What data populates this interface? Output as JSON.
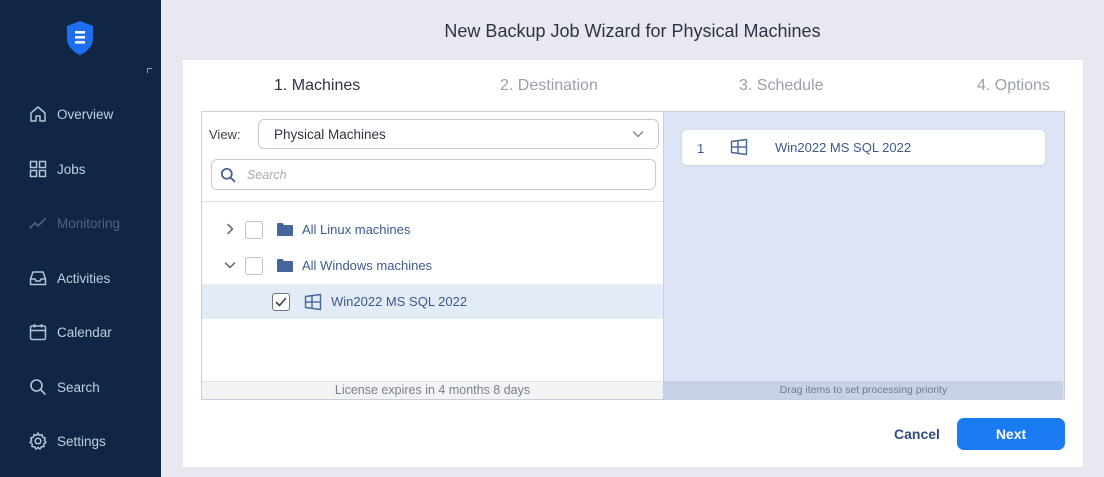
{
  "app": {
    "title": "New Backup Job Wizard for Physical Machines",
    "logo_icon": "shield-logo-icon",
    "accent_color": "#1a7af0"
  },
  "sidebar": {
    "items": [
      {
        "label": "Overview",
        "icon": "home-icon",
        "enabled": true
      },
      {
        "label": "Jobs",
        "icon": "grid-icon",
        "enabled": true
      },
      {
        "label": "Monitoring",
        "icon": "chart-line-icon",
        "enabled": false
      },
      {
        "label": "Activities",
        "icon": "inbox-icon",
        "enabled": true
      },
      {
        "label": "Calendar",
        "icon": "calendar-icon",
        "enabled": true
      },
      {
        "label": "Search",
        "icon": "search-icon",
        "enabled": true
      },
      {
        "label": "Settings",
        "icon": "gear-icon",
        "enabled": true
      }
    ]
  },
  "wizard": {
    "steps": [
      {
        "label": "1. Machines",
        "active": true
      },
      {
        "label": "2. Destination",
        "active": false
      },
      {
        "label": "3. Schedule",
        "active": false
      },
      {
        "label": "4. Options",
        "active": false
      }
    ]
  },
  "inventory": {
    "view_label": "View:",
    "view_value": "Physical Machines",
    "search_placeholder": "Search",
    "tree": [
      {
        "label": "All Linux machines",
        "expanded": false,
        "checked": false,
        "icon": "folder-icon"
      },
      {
        "label": "All Windows machines",
        "expanded": true,
        "checked": false,
        "icon": "folder-icon"
      },
      {
        "label": "Win2022 MS SQL 2022",
        "checked": true,
        "selected": true,
        "icon": "windows-icon"
      }
    ],
    "footer": "License expires in 4 months 8 days"
  },
  "selected": {
    "items": [
      {
        "num": "1",
        "name": "Win2022 MS SQL 2022",
        "icon": "windows-icon"
      }
    ],
    "footer": "Drag items to set processing priority"
  },
  "buttons": {
    "cancel": "Cancel",
    "next": "Next"
  }
}
